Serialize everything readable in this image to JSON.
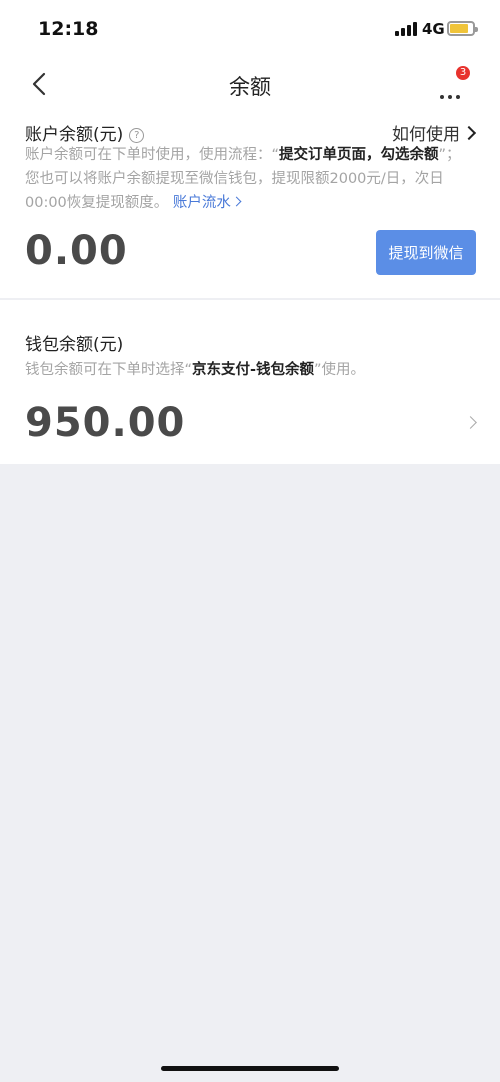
{
  "status_bar": {
    "time": "12:18",
    "network": "4G",
    "battery_level": 0.8,
    "battery_color": "#f0c43a"
  },
  "nav": {
    "title": "余额",
    "back_icon": "chevron-left-icon",
    "more_icon": "more-dots-icon",
    "badge_count": "3",
    "badge_color": "#e8322d"
  },
  "account": {
    "title": "账户余额(元)",
    "help_icon": "?",
    "howto_label": "如何使用",
    "desc_part1": "账户余额可在下单时使用，使用流程：“",
    "desc_bold": "提交订单页面，勾选余额",
    "desc_part2": "”；您也可以将账户余额提现至微信钱包，提现限额2000元/日，次日00:00恢复提现额度。",
    "flow_link": "账户流水",
    "amount": "0.00",
    "withdraw_label": "提现到微信",
    "withdraw_color": "#5b8ee6"
  },
  "wallet": {
    "title": "钱包余额(元)",
    "desc_part1": "钱包余额可在下单时选择“",
    "desc_bold": "京东支付-钱包余额",
    "desc_part2": "”使用。",
    "amount": "950.00"
  }
}
